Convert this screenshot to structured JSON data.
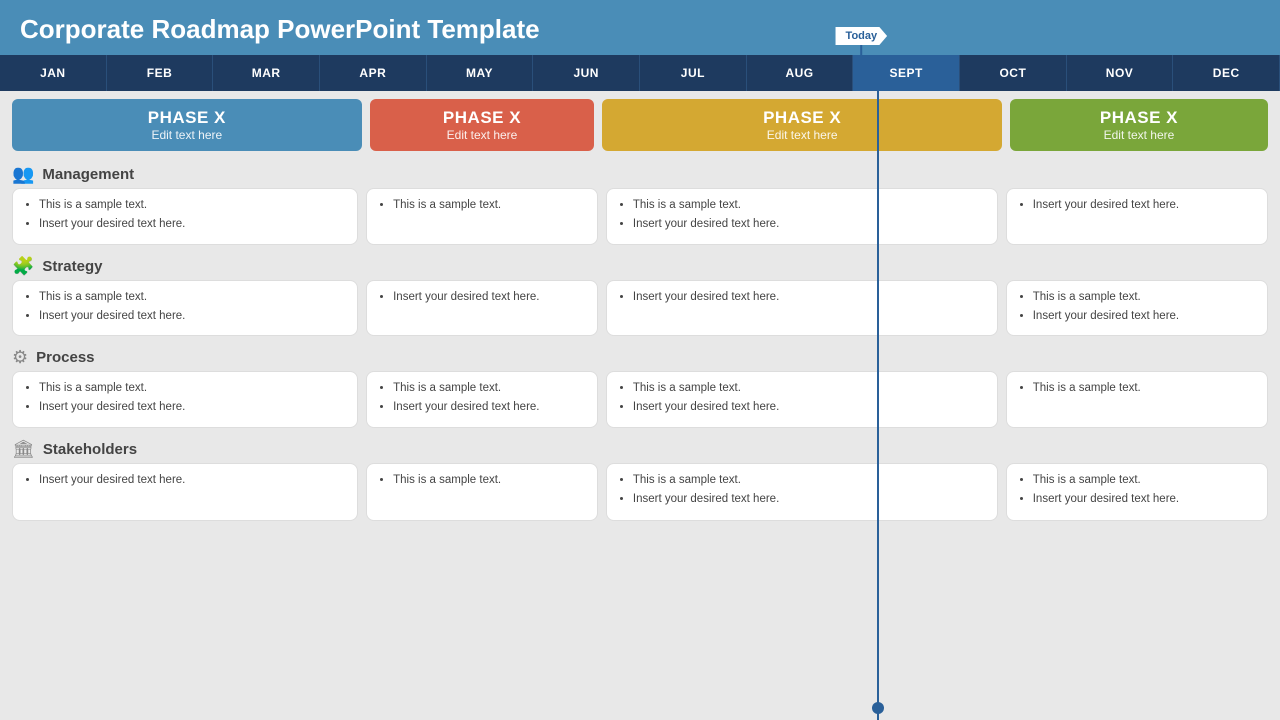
{
  "title": "Corporate Roadmap PowerPoint Template",
  "today_label": "Today",
  "months": [
    {
      "label": "JAN",
      "active": false
    },
    {
      "label": "FEB",
      "active": false
    },
    {
      "label": "MAR",
      "active": false
    },
    {
      "label": "APR",
      "active": false
    },
    {
      "label": "MAY",
      "active": false
    },
    {
      "label": "JUN",
      "active": false
    },
    {
      "label": "JUL",
      "active": false
    },
    {
      "label": "AUG",
      "active": false
    },
    {
      "label": "SEPT",
      "active": true
    },
    {
      "label": "OCT",
      "active": false
    },
    {
      "label": "NOV",
      "active": false
    },
    {
      "label": "DEC",
      "active": false
    }
  ],
  "phases": [
    {
      "label": "PHASE X",
      "subtitle": "Edit text here",
      "color": "blue"
    },
    {
      "label": "PHASE X",
      "subtitle": "Edit text here",
      "color": "orange"
    },
    {
      "label": "PHASE X",
      "subtitle": "Edit text here",
      "color": "yellow"
    },
    {
      "label": "PHASE X",
      "subtitle": "Edit text here",
      "color": "green"
    }
  ],
  "sections": [
    {
      "name": "Management",
      "icon": "👥",
      "cards": [
        {
          "items": [
            "This is a sample text.",
            "Insert your desired text here."
          ]
        },
        {
          "items": [
            "This is a sample text."
          ]
        },
        {
          "items": [
            "This is a sample text.",
            "Insert your desired text here."
          ]
        },
        {
          "items": [
            "Insert your desired text here."
          ]
        }
      ]
    },
    {
      "name": "Strategy",
      "icon": "🧩",
      "cards": [
        {
          "items": [
            "This is a sample text.",
            "Insert your desired text here."
          ]
        },
        {
          "items": [
            "Insert your desired text here."
          ]
        },
        {
          "items": [
            "Insert your desired text here."
          ]
        },
        {
          "items": [
            "This is a sample text.",
            "Insert your desired text here."
          ]
        }
      ]
    },
    {
      "name": "Process",
      "icon": "🔄",
      "cards": [
        {
          "items": [
            "This is a sample text.",
            "Insert your desired text here."
          ]
        },
        {
          "items": [
            "This is a sample text.",
            "Insert your desired text here."
          ]
        },
        {
          "items": [
            "This is a sample text.",
            "Insert your desired text here."
          ]
        },
        {
          "items": [
            "This is a sample text."
          ]
        }
      ]
    },
    {
      "name": "Stakeholders",
      "icon": "🏛",
      "cards": [
        {
          "items": [
            "Insert your desired text here."
          ]
        },
        {
          "items": [
            "This is a sample text."
          ]
        },
        {
          "items": [
            "This is a sample text.",
            "Insert your desired text here."
          ]
        },
        {
          "items": [
            "This is a sample text.",
            "Insert your desired text here."
          ]
        }
      ]
    }
  ]
}
